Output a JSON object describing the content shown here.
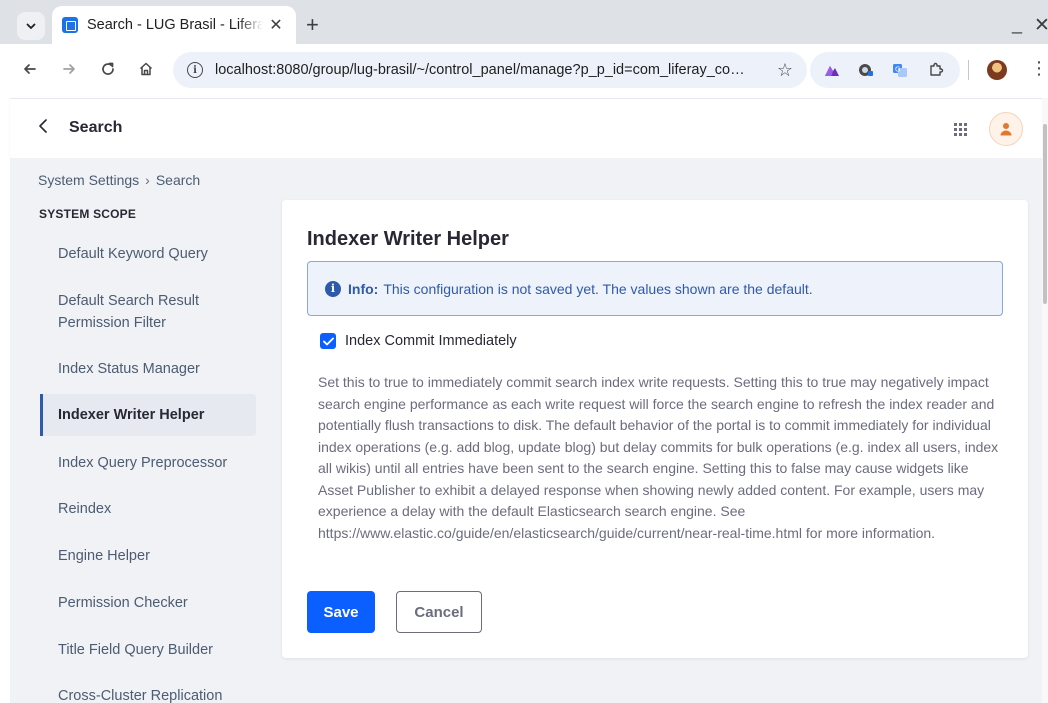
{
  "browser": {
    "tab_title": "Search - LUG Brasil - Liferay",
    "url": "localhost:8080/group/lug-brasil/~/control_panel/manage?p_p_id=com_liferay_co…",
    "new_tab_symbol": "+",
    "close_symbol": "✕"
  },
  "header": {
    "title": "Search"
  },
  "breadcrumb": {
    "items": [
      "System Settings",
      "Search"
    ],
    "separator": "›"
  },
  "sidebar": {
    "scope_title": "SYSTEM SCOPE",
    "items": [
      {
        "label": "Default Keyword Query"
      },
      {
        "label": "Default Search Result Permission Filter"
      },
      {
        "label": "Index Status Manager"
      },
      {
        "label": "Indexer Writer Helper",
        "active": true
      },
      {
        "label": "Index Query Preprocessor"
      },
      {
        "label": "Reindex"
      },
      {
        "label": "Engine Helper"
      },
      {
        "label": "Permission Checker"
      },
      {
        "label": "Title Field Query Builder"
      },
      {
        "label": "Cross-Cluster Replication"
      }
    ]
  },
  "form": {
    "title": "Indexer Writer Helper",
    "alert": {
      "label": "Info:",
      "message": "This configuration is not saved yet. The values shown are the default."
    },
    "checkbox": {
      "label": "Index Commit Immediately",
      "checked": true
    },
    "help_text": "Set this to true to immediately commit search index write requests. Setting this to true may negatively impact search engine performance as each write request will force the search engine to refresh the index reader and potentially flush transactions to disk. The default behavior of the portal is to commit immediately for individual index operations (e.g. add blog, update blog) but delay commits for bulk operations (e.g. index all users, index all wikis) until all entries have been sent to the search engine. Setting this to false may cause widgets like Asset Publisher to exhibit a delayed response when showing newly added content. For example, users may experience a delay with the default Elasticsearch search engine. See https://www.elastic.co/guide/en/elasticsearch/guide/current/near-real-time.html for more information.",
    "save_label": "Save",
    "cancel_label": "Cancel"
  },
  "colors": {
    "primary": "#0b5fff",
    "info": "#2e5aac",
    "info_bg": "#eef2fa",
    "page_bg": "#f1f2f5",
    "sidebar_active_bg": "#e6e9ef"
  }
}
